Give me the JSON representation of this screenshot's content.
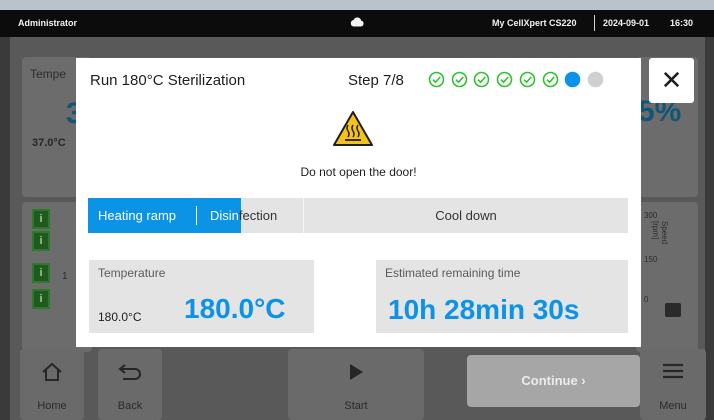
{
  "status_bar": {
    "user": "Administrator",
    "device": "My CellXpert CS220",
    "date": "2024-09-01",
    "time": "16:30",
    "cloud_icon": "cloud-icon"
  },
  "background": {
    "temperature_label": "Tempe",
    "temperature_big": "3",
    "temperature_small": "37.0°C",
    "right_value": "5%",
    "info_icons": [
      "i",
      "i",
      "i",
      "i"
    ],
    "info_row_text": "1",
    "axis_300": "300",
    "axis_150": "150",
    "axis_0": "0",
    "axis_title": "Speed [rpm]",
    "buttons": {
      "home": "Home",
      "back": "Back",
      "start": "Start",
      "menu": "Menu"
    }
  },
  "modal": {
    "title": "Run 180°C Sterilization",
    "step_label": "Step 7/8",
    "steps_completed": 6,
    "steps_total": 8,
    "current_step": 7,
    "warning_text": "Do not open the door!",
    "phases": {
      "heating": "Heating ramp",
      "disinfection_visible": "Disin",
      "disinfection_rest": "fection",
      "cool_down": "Cool down"
    },
    "temperature": {
      "label": "Temperature",
      "setpoint": "180.0°C",
      "value": "180.0°C"
    },
    "remaining": {
      "label": "Estimated remaining time",
      "value": "10h 28min 30s"
    },
    "close_symbol": "✕"
  },
  "continue_label": "Continue ›",
  "colors": {
    "accent": "#0b93e6",
    "step_done": "#2ec22e",
    "step_pending": "#d0d0d0",
    "warning": "#f3c21b"
  }
}
